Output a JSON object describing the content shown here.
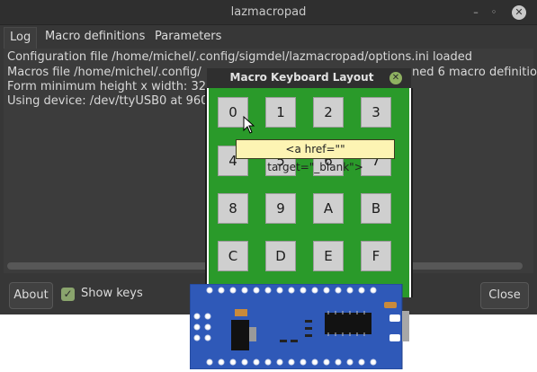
{
  "window": {
    "title": "lazmacropad",
    "controls": [
      "minimize-icon",
      "maximize-icon",
      "close-icon"
    ]
  },
  "tabs": [
    {
      "label": "Log",
      "active": true
    },
    {
      "label": "Macro definitions",
      "active": false
    },
    {
      "label": "Parameters",
      "active": false
    }
  ],
  "log": {
    "lines": [
      "Configuration file /home/michel/.config/sigmdel/lazmacropad/options.ini loaded",
      "Macros file /home/michel/.config/",
      "Form minimum height x width: 32",
      "Using device: /dev/ttyUSB0 at 960"
    ],
    "line2_tail": "ned 6 macro definition"
  },
  "footer": {
    "about_label": "About",
    "show_keys_label": "Show keys",
    "show_keys_checked": true,
    "close_label": "Close"
  },
  "popup": {
    "title": "Macro Keyboard Layout",
    "keys": [
      "0",
      "1",
      "2",
      "3",
      "4",
      "5",
      "6",
      "7",
      "8",
      "9",
      "A",
      "B",
      "C",
      "D",
      "E",
      "F"
    ],
    "tooltip": "<a href=\"\" target=\"_blank\">"
  },
  "colors": {
    "window_bg": "#373737",
    "pcb_green": "#2a9a2a",
    "board_blue": "#2f59b8",
    "tooltip_bg": "#fdf4b3",
    "accent_green": "#8fb161"
  }
}
